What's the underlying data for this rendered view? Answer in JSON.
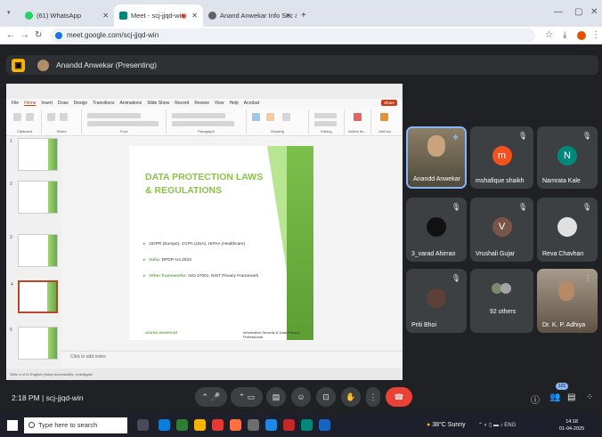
{
  "browser": {
    "tabs": [
      {
        "label": "(61) WhatsApp",
        "color": "#25d366",
        "active": false
      },
      {
        "label": "Meet - scj-jjqd-win",
        "color": "#00897b",
        "active": true
      },
      {
        "label": "Anand Anwekar Info Sec & Da",
        "color": "#5f6368",
        "active": false
      }
    ],
    "new_tab": "+",
    "url": "meet.google.com/scj-jjqd-win"
  },
  "meet": {
    "presenting": "Anandd Anwekar (Presenting)",
    "time": "2:18 PM",
    "separator": "|",
    "code": "scj-jjqd-win",
    "people_count": "101",
    "tiles": [
      {
        "name": "Anandd Anwekar",
        "initial": "",
        "color": "#6d6552"
      },
      {
        "name": "mshafique shaikh",
        "initial": "m",
        "color": "#f4511e"
      },
      {
        "name": "Namrata Kale",
        "initial": "N",
        "color": "#00897b"
      },
      {
        "name": "3_varad Ahirrao",
        "initial": "",
        "color": "#111111"
      },
      {
        "name": "Vrushali Gujar",
        "initial": "V",
        "color": "#795548"
      },
      {
        "name": "Reva Chavhan",
        "initial": "",
        "color": "#e0e0e0"
      },
      {
        "name": "Priti Bhoi",
        "initial": "",
        "color": "#5d4037"
      },
      {
        "name": "92 others",
        "initial": "",
        "color": "#7b8a6c"
      },
      {
        "name": "Dr. K. P. Adhiya",
        "initial": "",
        "color": "#8d7a66"
      }
    ]
  },
  "ppt": {
    "menu": [
      "File",
      "Home",
      "Insert",
      "Draw",
      "Design",
      "Transitions",
      "Animations",
      "Slide Show",
      "Record",
      "Review",
      "View",
      "Help",
      "Acrobat"
    ],
    "share": "Share",
    "ribbon_groups": [
      "Clipboard",
      "Slides",
      "Font",
      "Paragraph",
      "Drawing",
      "Editing",
      "Adobe Ac...",
      "Add-ins"
    ],
    "slide": {
      "title_line1": "DATA PROTECTION LAWS",
      "title_line2": "& REGULATIONS",
      "b1": "GDPR (Europe), CCPA (USA), HIPAA (Healthcare)",
      "b2_key": "India:",
      "b2_val": "DPDP Act 2023",
      "b3_key": "Other frameworks:",
      "b3_val": "ISO 27001, NIST Privacy Framework",
      "footer_left": "ANAND ANWEKAR",
      "footer_right": "Information Security & Data Privacy Professional"
    },
    "notes": "Click to add notes",
    "status": "Slide 4 of 11    English (India)    Accessibility: Investigate"
  },
  "taskbar": {
    "search_placeholder": "Type here to search",
    "weather": "38°C Sunny",
    "time": "14:18",
    "date": "01-04-2025",
    "lang": "ENG"
  }
}
